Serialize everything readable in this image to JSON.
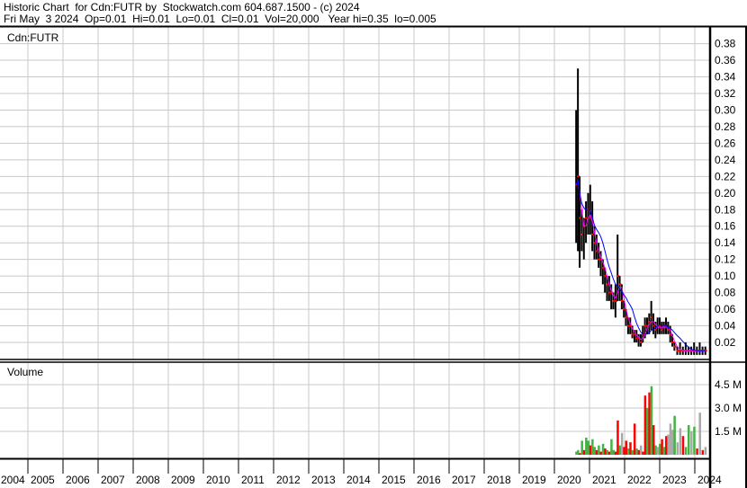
{
  "header": {
    "title": "Historic Chart  for Cdn:FUTR by  Stockwatch.com 604.687.1500 - (c) 2024",
    "quote": "Fri May  3 2024  Op=0.01  Hi=0.01  Lo=0.01  Cl=0.01  Vol=20,000   Year hi=0.35  lo=0.005"
  },
  "chart_data": {
    "type": "line",
    "symbol_label": "Cdn:FUTR",
    "volume_label": "Volume",
    "price_axis": {
      "ylim": [
        0,
        0.39
      ],
      "ticks": [
        "0.02",
        "0.04",
        "0.06",
        "0.08",
        "0.10",
        "0.12",
        "0.14",
        "0.16",
        "0.18",
        "0.20",
        "0.22",
        "0.24",
        "0.26",
        "0.28",
        "0.30",
        "0.32",
        "0.34",
        "0.36",
        "0.38"
      ]
    },
    "volume_axis": {
      "ylim_millions": [
        0,
        5.5
      ],
      "ticks": [
        {
          "value": 1.5,
          "label": "1.5 M"
        },
        {
          "value": 3.0,
          "label": "3.0 M"
        },
        {
          "value": 4.5,
          "label": "4.5 M"
        }
      ]
    },
    "x_axis": {
      "xlim": [
        2004,
        2024.45
      ],
      "years": [
        "2004",
        "2005",
        "2006",
        "2007",
        "2008",
        "2009",
        "2010",
        "2011",
        "2012",
        "2013",
        "2014",
        "2015",
        "2016",
        "2017",
        "2018",
        "2019",
        "2020",
        "2021",
        "2022",
        "2023",
        "2024"
      ]
    },
    "colors": {
      "bar": "#000000",
      "close": "#ff0000",
      "ma_short": "#ff00ff",
      "ma_long": "#0000ff",
      "vol_up": "#44b244",
      "vol_down": "#ff0000",
      "vol_flat": "#a8a8a8",
      "grid": "#c8c8c8"
    },
    "ohlc": [
      [
        2020.62,
        0.3,
        0.14,
        0.21
      ],
      [
        2020.67,
        0.35,
        0.13,
        0.22
      ],
      [
        2020.72,
        0.22,
        0.11,
        0.17
      ],
      [
        2020.78,
        0.18,
        0.13,
        0.15
      ],
      [
        2020.84,
        0.17,
        0.12,
        0.16
      ],
      [
        2020.9,
        0.19,
        0.14,
        0.17
      ],
      [
        2020.96,
        0.2,
        0.15,
        0.18
      ],
      [
        2021.02,
        0.21,
        0.15,
        0.17
      ],
      [
        2021.08,
        0.19,
        0.13,
        0.15
      ],
      [
        2021.14,
        0.16,
        0.12,
        0.14
      ],
      [
        2021.2,
        0.15,
        0.12,
        0.13
      ],
      [
        2021.26,
        0.14,
        0.11,
        0.12
      ],
      [
        2021.32,
        0.13,
        0.1,
        0.12
      ],
      [
        2021.38,
        0.12,
        0.09,
        0.11
      ],
      [
        2021.44,
        0.11,
        0.08,
        0.1
      ],
      [
        2021.5,
        0.1,
        0.07,
        0.09
      ],
      [
        2021.56,
        0.1,
        0.07,
        0.08
      ],
      [
        2021.62,
        0.09,
        0.06,
        0.08
      ],
      [
        2021.68,
        0.08,
        0.06,
        0.07
      ],
      [
        2021.74,
        0.09,
        0.05,
        0.07
      ],
      [
        2021.8,
        0.15,
        0.07,
        0.1
      ],
      [
        2021.86,
        0.1,
        0.07,
        0.09
      ],
      [
        2021.92,
        0.09,
        0.06,
        0.07
      ],
      [
        2021.98,
        0.07,
        0.05,
        0.06
      ],
      [
        2022.04,
        0.06,
        0.04,
        0.05
      ],
      [
        2022.1,
        0.05,
        0.03,
        0.04
      ],
      [
        2022.16,
        0.05,
        0.03,
        0.04
      ],
      [
        2022.22,
        0.04,
        0.025,
        0.03
      ],
      [
        2022.28,
        0.035,
        0.02,
        0.03
      ],
      [
        2022.34,
        0.035,
        0.02,
        0.025
      ],
      [
        2022.4,
        0.03,
        0.015,
        0.025
      ],
      [
        2022.46,
        0.03,
        0.015,
        0.02
      ],
      [
        2022.52,
        0.04,
        0.02,
        0.03
      ],
      [
        2022.58,
        0.05,
        0.025,
        0.04
      ],
      [
        2022.64,
        0.05,
        0.03,
        0.04
      ],
      [
        2022.7,
        0.055,
        0.03,
        0.045
      ],
      [
        2022.76,
        0.07,
        0.035,
        0.05
      ],
      [
        2022.82,
        0.055,
        0.03,
        0.04
      ],
      [
        2022.88,
        0.045,
        0.025,
        0.035
      ],
      [
        2022.94,
        0.05,
        0.03,
        0.04
      ],
      [
        2023.0,
        0.05,
        0.03,
        0.04
      ],
      [
        2023.06,
        0.045,
        0.03,
        0.035
      ],
      [
        2023.12,
        0.045,
        0.03,
        0.04
      ],
      [
        2023.18,
        0.05,
        0.03,
        0.04
      ],
      [
        2023.24,
        0.045,
        0.03,
        0.035
      ],
      [
        2023.3,
        0.04,
        0.02,
        0.03
      ],
      [
        2023.36,
        0.03,
        0.015,
        0.02
      ],
      [
        2023.42,
        0.02,
        0.01,
        0.015
      ],
      [
        2023.5,
        0.015,
        0.005,
        0.01
      ],
      [
        2023.58,
        0.02,
        0.005,
        0.01
      ],
      [
        2023.66,
        0.015,
        0.005,
        0.01
      ],
      [
        2023.74,
        0.02,
        0.005,
        0.01
      ],
      [
        2023.82,
        0.015,
        0.005,
        0.01
      ],
      [
        2023.9,
        0.015,
        0.005,
        0.01
      ],
      [
        2023.98,
        0.02,
        0.005,
        0.01
      ],
      [
        2024.06,
        0.015,
        0.005,
        0.01
      ],
      [
        2024.14,
        0.02,
        0.005,
        0.01
      ],
      [
        2024.22,
        0.015,
        0.005,
        0.01
      ],
      [
        2024.3,
        0.015,
        0.005,
        0.01
      ]
    ],
    "volume_millions": [
      [
        2020.62,
        0.2,
        "up"
      ],
      [
        2020.67,
        0.3,
        "up"
      ],
      [
        2020.72,
        0.1,
        "down"
      ],
      [
        2020.78,
        0.9,
        "up"
      ],
      [
        2020.84,
        0.3,
        "down"
      ],
      [
        2020.9,
        1.1,
        "up"
      ],
      [
        2020.96,
        0.9,
        "up"
      ],
      [
        2021.02,
        0.6,
        "down"
      ],
      [
        2021.08,
        1.0,
        "up"
      ],
      [
        2021.14,
        0.5,
        "up"
      ],
      [
        2021.2,
        0.3,
        "down"
      ],
      [
        2021.26,
        0.6,
        "up"
      ],
      [
        2021.32,
        0.2,
        "down"
      ],
      [
        2021.38,
        0.7,
        "up"
      ],
      [
        2021.44,
        0.4,
        "down"
      ],
      [
        2021.5,
        0.3,
        "up"
      ],
      [
        2021.56,
        0.2,
        "down"
      ],
      [
        2021.62,
        1.0,
        "up"
      ],
      [
        2021.68,
        0.3,
        "up"
      ],
      [
        2021.74,
        0.2,
        "down"
      ],
      [
        2021.8,
        2.2,
        "down"
      ],
      [
        2021.86,
        0.6,
        "up"
      ],
      [
        2021.92,
        1.4,
        "flat"
      ],
      [
        2021.98,
        0.5,
        "down"
      ],
      [
        2022.04,
        0.9,
        "down"
      ],
      [
        2022.1,
        0.4,
        "up"
      ],
      [
        2022.16,
        0.8,
        "down"
      ],
      [
        2022.22,
        0.3,
        "up"
      ],
      [
        2022.28,
        2.0,
        "down"
      ],
      [
        2022.34,
        0.4,
        "up"
      ],
      [
        2022.4,
        0.3,
        "down"
      ],
      [
        2022.46,
        0.6,
        "flat"
      ],
      [
        2022.52,
        0.2,
        "down"
      ],
      [
        2022.58,
        3.8,
        "down"
      ],
      [
        2022.64,
        3.0,
        "up"
      ],
      [
        2022.7,
        4.0,
        "down"
      ],
      [
        2022.76,
        4.4,
        "up"
      ],
      [
        2022.82,
        1.9,
        "down"
      ],
      [
        2022.88,
        0.6,
        "up"
      ],
      [
        2022.94,
        0.5,
        "flat"
      ],
      [
        2023.0,
        0.7,
        "up"
      ],
      [
        2023.06,
        1.0,
        "down"
      ],
      [
        2023.12,
        0.5,
        "up"
      ],
      [
        2023.18,
        1.2,
        "down"
      ],
      [
        2023.24,
        1.3,
        "flat"
      ],
      [
        2023.3,
        2.0,
        "flat"
      ],
      [
        2023.36,
        1.6,
        "flat"
      ],
      [
        2023.42,
        2.5,
        "up"
      ],
      [
        2023.5,
        0.8,
        "flat"
      ],
      [
        2023.58,
        1.7,
        "flat"
      ],
      [
        2023.66,
        1.2,
        "down"
      ],
      [
        2023.74,
        0.5,
        "up"
      ],
      [
        2023.82,
        1.9,
        "up"
      ],
      [
        2023.9,
        1.5,
        "flat"
      ],
      [
        2023.98,
        1.8,
        "up"
      ],
      [
        2024.06,
        0.4,
        "down"
      ],
      [
        2024.14,
        2.7,
        "flat"
      ],
      [
        2024.22,
        0.3,
        "down"
      ],
      [
        2024.3,
        0.5,
        "flat"
      ]
    ]
  }
}
